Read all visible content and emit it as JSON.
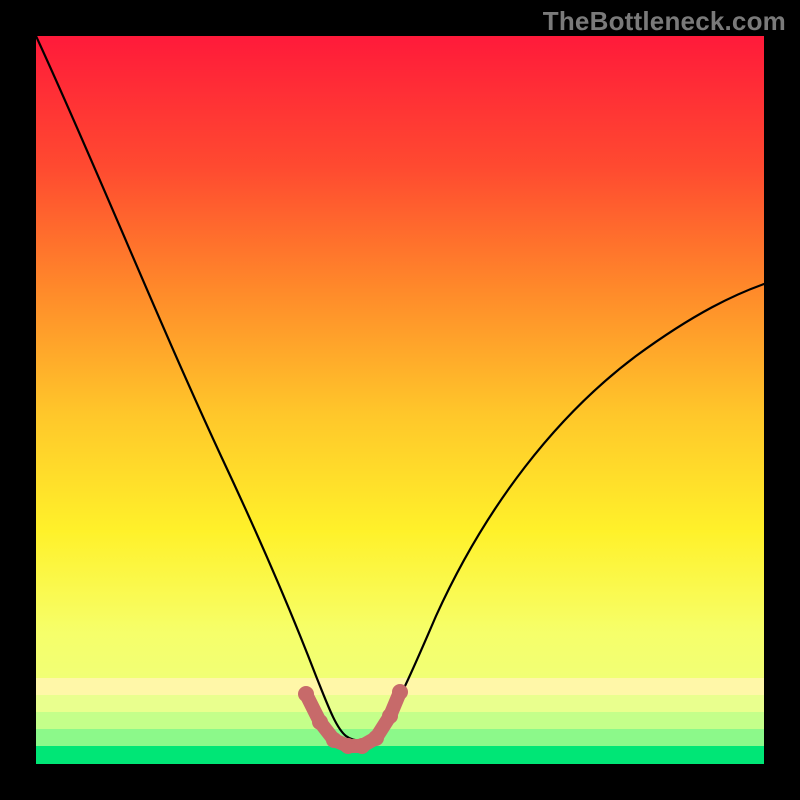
{
  "watermark": "TheBottleneck.com",
  "chart_data": {
    "type": "line",
    "title": "",
    "xlabel": "",
    "ylabel": "",
    "xlim": [
      0,
      100
    ],
    "ylim": [
      0,
      100
    ],
    "series": [
      {
        "name": "curve",
        "x": [
          0,
          5,
          10,
          15,
          20,
          25,
          30,
          33,
          36,
          38,
          40,
          42,
          44,
          46,
          48,
          50,
          55,
          60,
          65,
          70,
          75,
          80,
          85,
          90,
          95,
          100
        ],
        "y": [
          100,
          88,
          76,
          65,
          54,
          43,
          32,
          20,
          10,
          5,
          2,
          1,
          1,
          2,
          5,
          10,
          20,
          30,
          38,
          44,
          50,
          55,
          59,
          62,
          64,
          66
        ]
      },
      {
        "name": "bottom-marker",
        "x": [
          36,
          38,
          40,
          42,
          44,
          46,
          48
        ],
        "y": [
          10,
          5,
          2,
          1,
          1,
          2,
          5
        ]
      }
    ],
    "background_gradient": [
      "#ff1a3a",
      "#ff6a2a",
      "#ffb92a",
      "#fff12a",
      "#f6ff6a",
      "#9cff8a",
      "#00e676"
    ],
    "bottom_band_colors": [
      "#fff59a",
      "#d6ff8a",
      "#7cf98a",
      "#00e676"
    ],
    "curve_color": "#000000",
    "marker_color": "#c76a6a"
  }
}
